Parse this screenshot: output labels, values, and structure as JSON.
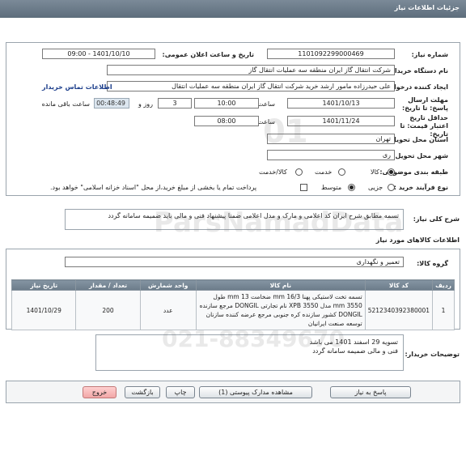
{
  "header": {
    "title": "جزئیات اطلاعات نیاز"
  },
  "info": {
    "need_number_label": "شماره نیاز:",
    "need_number": "1101092299000469",
    "announce_label": "تاریخ و ساعت اعلان عمومی:",
    "announce_value": "1401/10/10 - 09:00",
    "buyer_org_label": "نام دستگاه خریدار:",
    "buyer_org": "شرکت انتقال گاز ایران منطقه سه عملیات انتقال گاز",
    "creator_label": "ایجاد کننده درخواست:",
    "creator": "علی حیدرزاده مامور ارشد خرید شرکت انتقال گاز ایران منطقه سه عملیات انتقال",
    "contact_link": "اطلاعات تماس خریدار",
    "reply_deadline_label": "مهلت ارسال پاسخ: تا تاریخ:",
    "reply_date": "1401/10/13",
    "time_label": "ساعت",
    "reply_time": "10:00",
    "days_value": "3",
    "days_label": "روز و",
    "remaining_time": "00:48:49",
    "remaining_label": "ساعت باقی مانده",
    "validity_label": "حداقل تاریخ اعتبار قیمت: تا تاریخ:",
    "validity_date": "1401/11/24",
    "validity_time_label": "ساعت",
    "validity_time": "08:00",
    "province_label": "استان محل تحویل:",
    "province": "تهران",
    "city_label": "شهر محل تحویل:",
    "city": "ری",
    "category_label": "طبقه بندی موضوعی:",
    "category_options": [
      "کالا",
      "خدمت",
      "کالا/خدمت"
    ],
    "purchase_type_label": "نوع فرآیند خرید :",
    "purchase_type_options": [
      "جزیی",
      "متوسط"
    ],
    "payment_note": "پرداخت تمام یا بخشی از مبلغ خرید،از محل \"اسناد خزانه اسلامی\" خواهد بود."
  },
  "general": {
    "label": "شرح کلی نیاز:",
    "text": "تسمه مطابق شرح ایران کد اعلامی و مارک و مدل اعلامی ضمنا پیشنهاد فنی و مالی باید ضمیمه سامانه گردد"
  },
  "goods": {
    "section_title": "اطلاعات کالاهای مورد نیاز",
    "group_label": "گروه کالا:",
    "group_value": "تعمیر و نگهداری",
    "columns": [
      "ردیف",
      "کد کالا",
      "نام کالا",
      "واحد شمارش",
      "تعداد / مقدار",
      "تاریخ نیاز"
    ],
    "row": {
      "index": "1",
      "code": "5212340392380001",
      "name_line1": "تسمه تخت لاستیکی پهنا 16/3 mm ضخامت 13 mm طول",
      "name_line2": "3550 mm مدل XPB 3550 نام تجارتی DONGIL مرجع سازنده",
      "name_line3": "DONGIL کشور سازنده کره جنوبی مرجع عرضه کننده سازنان",
      "name_line4": "توسعه صنعت ایرانیان",
      "unit": "عدد",
      "quantity": "200",
      "date": "1401/10/29"
    }
  },
  "buyer_notes": {
    "label": "توضیحات خریدار:",
    "line1": "تسویه 29 اسفند 1401 می باشد",
    "line2": "فنی و مالی ضمیمه سامانه گردد"
  },
  "buttons": {
    "reply": "پاسخ به نیاز",
    "attachments": "مشاهده مدارک پیوستی (1)",
    "print": "چاپ",
    "back": "بازگشت",
    "exit": "خروج"
  }
}
